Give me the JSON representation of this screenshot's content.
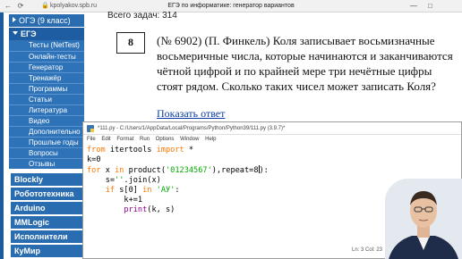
{
  "browser": {
    "url": "kpolyakov.spb.ru",
    "title": "ЕГЭ по информатике: генератор вариантов",
    "back_icon": "back-arrow-icon",
    "lock_icon": "lock-icon",
    "minimize": "—",
    "maximize": "□"
  },
  "sidebar": {
    "oge": "ОГЭ (9 класс)",
    "ege": "ЕГЭ",
    "items": [
      "Тесты (NetTest)",
      "Онлайн-тесты",
      "Генератор",
      "Тренажёр",
      "Программы",
      "Статьи",
      "Литература",
      "Видео",
      "Дополнительно",
      "Прошлые годы",
      "Вопросы",
      "Отзывы"
    ],
    "sections": [
      "Blockly",
      "Робототехника",
      "Arduino",
      "MMLogic",
      "Исполнители",
      "КуМир"
    ]
  },
  "task": {
    "total_label": "Всего задач: 314",
    "number": "8",
    "text": "(№ 6902) (П. Финкель) Коля записывает восьмизначные восьмеричные числа, которые начинаются и заканчиваются чётной цифрой и по крайней мере три нечётные цифры стоят рядом. Сколько таких чисел может записать Коля?",
    "show_answer": "Показать ответ"
  },
  "idle": {
    "title": "*111.py - C:/Users/1/AppData/Local/Programs/Python/Python39/111.py (3.9.7)*",
    "menu": [
      "File",
      "Edit",
      "Format",
      "Run",
      "Options",
      "Window",
      "Help"
    ],
    "status": "Ln: 3   Col: 23"
  },
  "colors": {
    "sidebar_blue": "#2e73b8",
    "keyword": "#ff7700",
    "builtin": "#900090",
    "string": "#00aa00",
    "link": "#0b3aa7"
  }
}
